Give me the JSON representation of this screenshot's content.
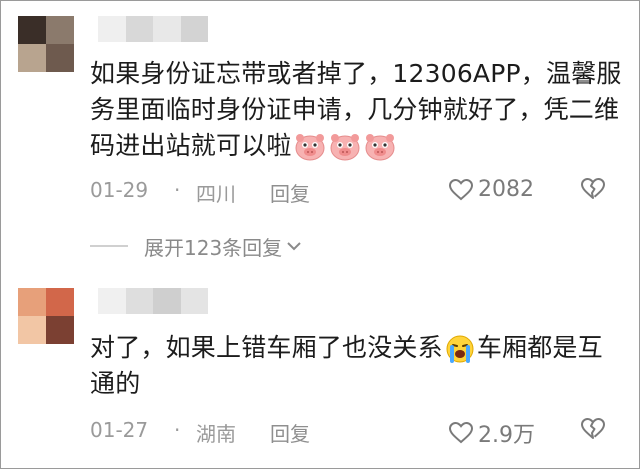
{
  "comments": [
    {
      "text": "如果身份证忘带或者掉了，12306APP，温馨服务里面临时身份证申请，几分钟就好了，凭二维码进出站就可以啦",
      "emoji": [
        "pig-face",
        "pig-face",
        "pig-face"
      ],
      "date": "01-29",
      "separator": "·",
      "location": "四川",
      "reply_label": "回复",
      "likes": "2082",
      "expand_label": "展开123条回复"
    },
    {
      "text_before": "对了，如果上错车厢了也没关系",
      "emoji": "crying-face",
      "text_after": "车厢都是互通的",
      "date": "01-27",
      "separator": "·",
      "location": "湖南",
      "reply_label": "回复",
      "likes": "2.9万"
    }
  ],
  "colors": {
    "text": "#1c1c1c",
    "meta": "#9a9a9a",
    "avatar1": [
      "#3a2e28",
      "#8b7a6c",
      "#b8a48f",
      "#6e5a4e"
    ],
    "avatar2": [
      "#e7a07a",
      "#d2674a",
      "#f2c6a5",
      "#7b4032"
    ]
  }
}
